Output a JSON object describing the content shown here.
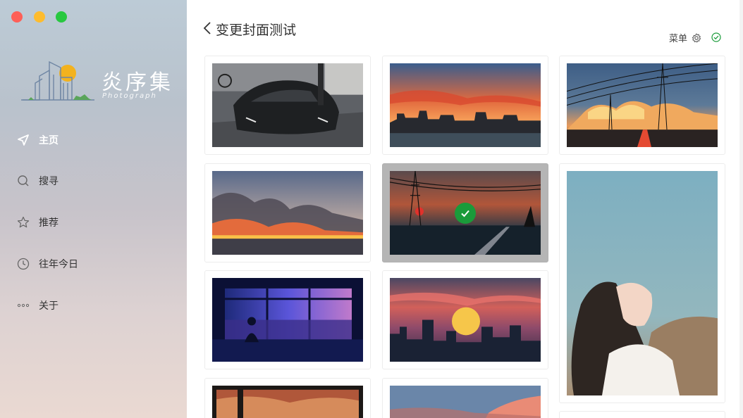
{
  "window": {
    "title": "变更封面测试"
  },
  "app": {
    "logo_text": "炎序集",
    "logo_sub": "Photograph"
  },
  "sidebar": {
    "items": [
      {
        "label": "主页",
        "icon": "navigation-arrow-icon",
        "active": true
      },
      {
        "label": "搜寻",
        "icon": "search-icon",
        "active": false
      },
      {
        "label": "推荐",
        "icon": "star-icon",
        "active": false
      },
      {
        "label": "往年今日",
        "icon": "clock-icon",
        "active": false
      },
      {
        "label": "关于",
        "icon": "more-dots-icon",
        "active": false
      }
    ]
  },
  "header": {
    "menu_label": "菜单",
    "menu_icon": "gear-icon",
    "confirm_icon": "check-circle-icon"
  },
  "gallery": {
    "items": [
      {
        "name": "photo-sports-car",
        "selected": false
      },
      {
        "name": "photo-sunset-city",
        "selected": false
      },
      {
        "name": "photo-power-lines-sunset",
        "selected": false
      },
      {
        "name": "photo-smoke-landscape",
        "selected": false
      },
      {
        "name": "photo-power-tower-dusk",
        "selected": true
      },
      {
        "name": "photo-woman-portrait",
        "selected": false
      },
      {
        "name": "photo-window-night",
        "selected": false
      },
      {
        "name": "photo-sun-city-skyline",
        "selected": false
      },
      {
        "name": "photo-dark-window-sunset",
        "selected": false
      },
      {
        "name": "photo-clouds-sunset",
        "selected": false
      }
    ]
  },
  "colors": {
    "accent_green": "#1a9b3a",
    "close": "#fe5f57",
    "minimize": "#febc2e",
    "maximize": "#28c840"
  }
}
